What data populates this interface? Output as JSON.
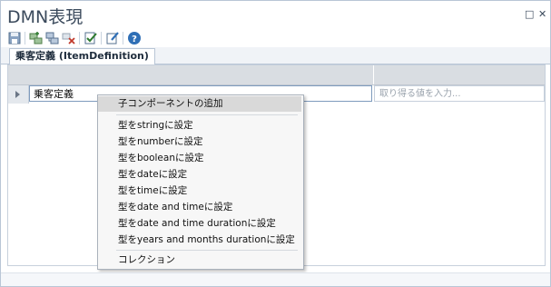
{
  "window": {
    "title": "DMN表現",
    "restore_glyph": "□",
    "close_glyph": "✕"
  },
  "toolbar": {
    "buttons": [
      "save-icon",
      "add-item-icon",
      "add-child-icon",
      "delete-icon",
      "validate-icon",
      "edit-icon",
      "help-icon"
    ]
  },
  "tabs": [
    {
      "label": "乗客定義 (ItemDefinition)"
    }
  ],
  "grid": {
    "row_name": "乗客定義",
    "value_placeholder": "取り得る値を入力..."
  },
  "context_menu": {
    "items": [
      "子コンポーネントの追加",
      "型をstringに設定",
      "型をnumberに設定",
      "型をbooleanに設定",
      "型をdateに設定",
      "型をtimeに設定",
      "型をdate and timeに設定",
      "型をdate and time durationに設定",
      "型をyears and months durationに設定",
      "コレクション"
    ]
  },
  "colors": {
    "accent": "#2f6fb6",
    "highlight": "#d9d9d9",
    "header": "#d9dde2"
  }
}
